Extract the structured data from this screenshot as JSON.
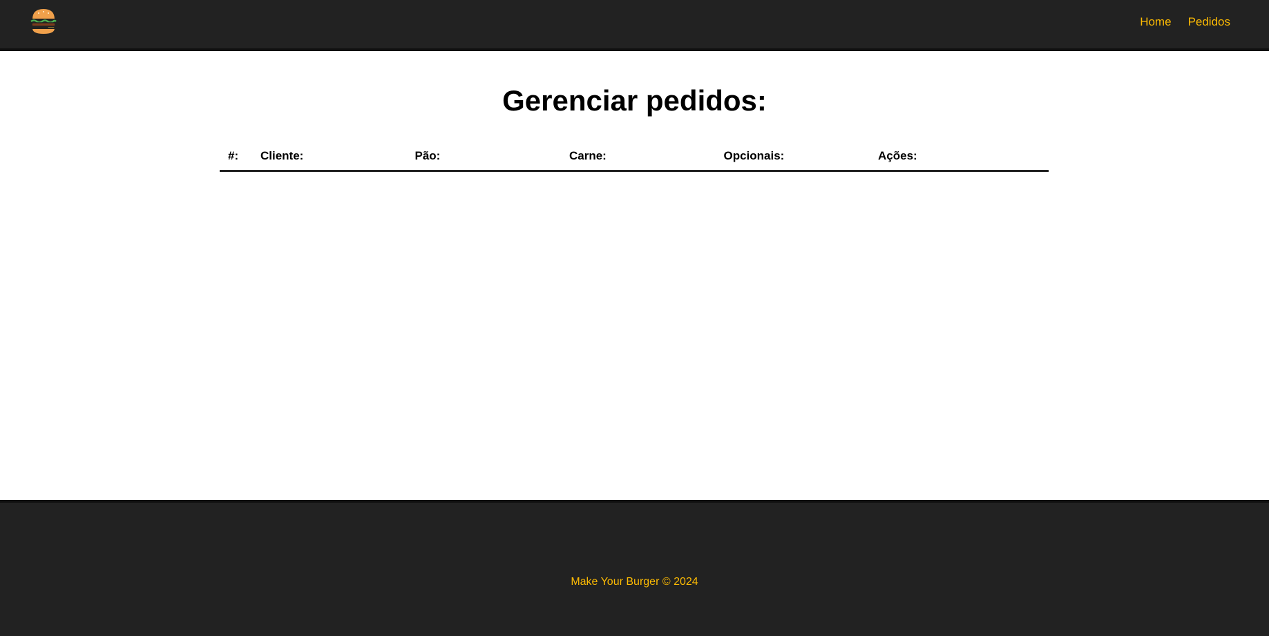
{
  "nav": {
    "logo_icon": "burger-icon",
    "links": [
      {
        "label": "Home"
      },
      {
        "label": "Pedidos"
      }
    ]
  },
  "main": {
    "title": "Gerenciar pedidos:",
    "table": {
      "headers": [
        "#:",
        "Cliente:",
        "Pão:",
        "Carne:",
        "Opcionais:",
        "Ações:"
      ],
      "rows": []
    }
  },
  "footer": {
    "text": "Make Your Burger © 2024"
  },
  "colors": {
    "nav_bg": "#222222",
    "accent": "#fcba03",
    "text": "#000000"
  }
}
